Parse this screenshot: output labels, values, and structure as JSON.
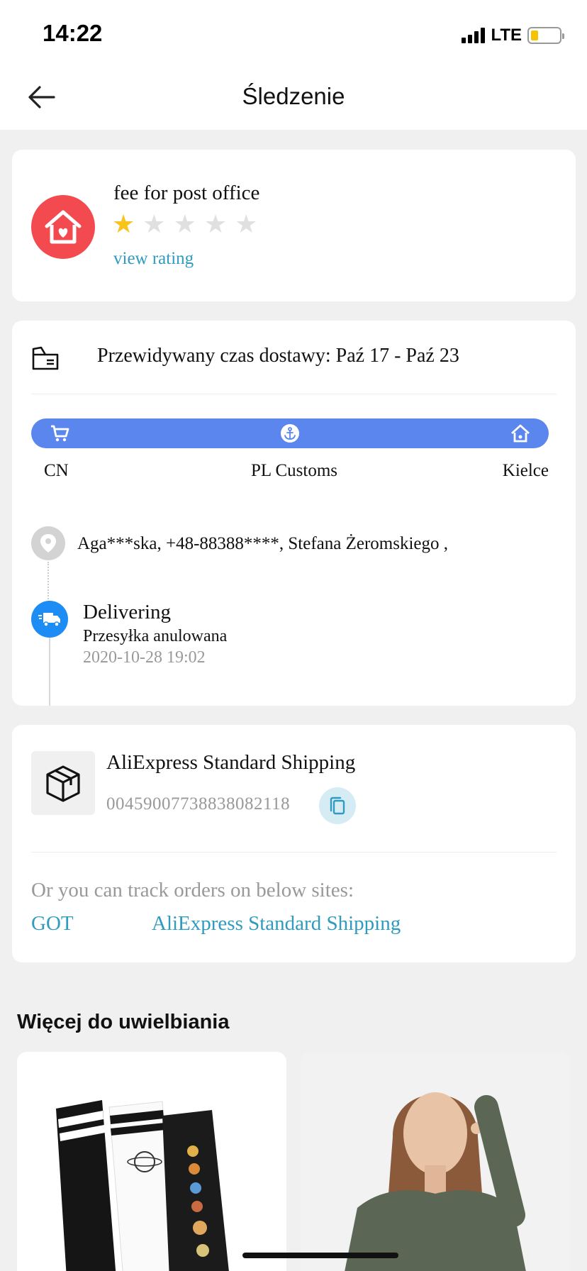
{
  "status_bar": {
    "time": "14:22",
    "network": "LTE",
    "battery_level": 0.25
  },
  "header": {
    "title": "Śledzenie",
    "back_icon": "arrow-left-icon"
  },
  "seller": {
    "name": "fee for post office",
    "rating": 1,
    "rating_max": 5,
    "view_rating_label": "view rating",
    "logo_icon": "house-heart-icon",
    "logo_color": "#f24a4f"
  },
  "delivery": {
    "estimate_text": "Przewidywany czas dostawy: Paź 17 - Paź 23",
    "progress_color": "#5a86ee",
    "stages": [
      {
        "label": "CN",
        "icon": "cart-icon"
      },
      {
        "label": "PL Customs",
        "icon": "anchor-icon"
      },
      {
        "label": "Kielce",
        "icon": "house-icon"
      }
    ],
    "address": "Aga***ska,  +48-88388****,  Stefana Żeromskiego ,",
    "event": {
      "title": "Delivering",
      "description": "Przesyłka anulowana",
      "timestamp": "2020-10-28 19:02"
    }
  },
  "shipping": {
    "carrier": "AliExpress Standard Shipping",
    "tracking_number": "0045900773883808211​8",
    "track_hint": "Or you can track orders on below sites:",
    "links": [
      "GOT",
      "AliExpress Standard Shipping"
    ]
  },
  "recommendations": {
    "title": "Więcej do uwielbiania"
  }
}
